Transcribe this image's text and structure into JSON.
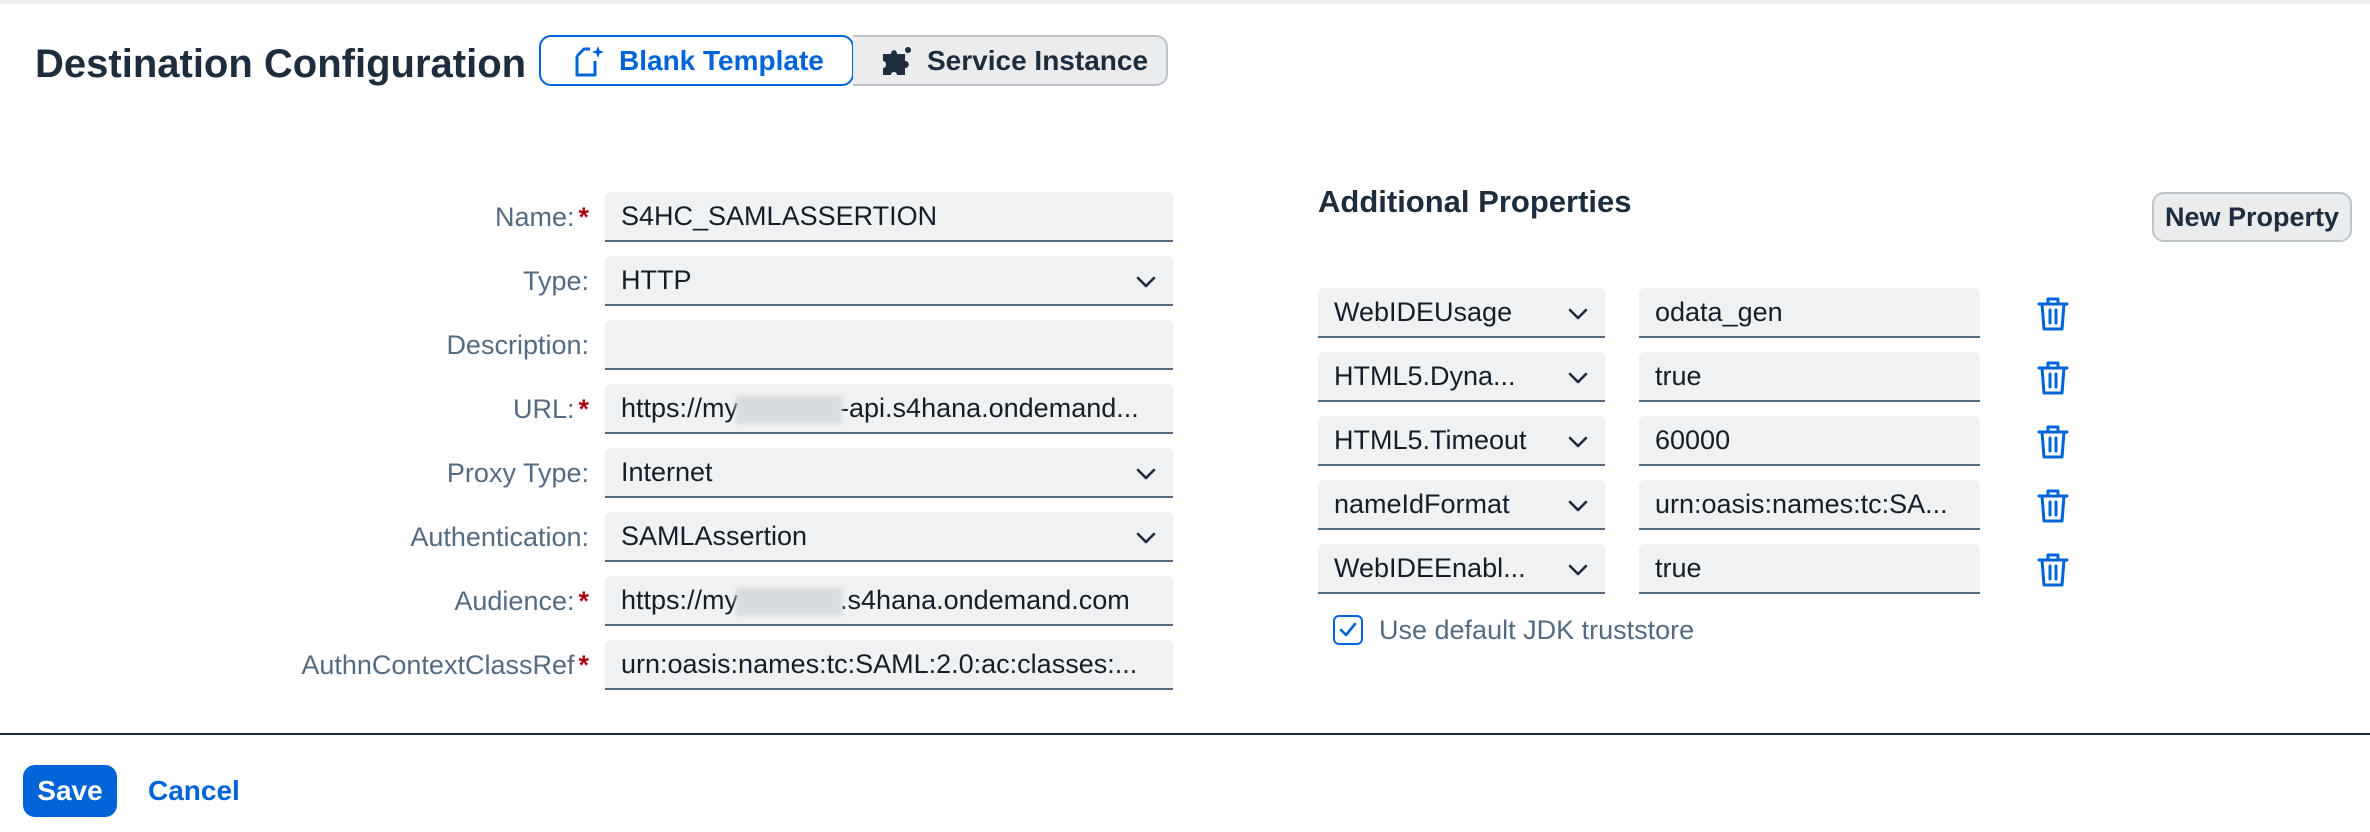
{
  "header": {
    "title": "Destination Configuration",
    "segments": [
      {
        "label": "Blank Template",
        "icon": "new-document-icon",
        "selected": true
      },
      {
        "label": "Service Instance",
        "icon": "puzzle-icon",
        "selected": false
      }
    ]
  },
  "form": {
    "name": {
      "label": "Name:",
      "required": true,
      "value": "S4HC_SAMLASSERTION"
    },
    "type": {
      "label": "Type:",
      "value": "HTTP"
    },
    "description": {
      "label": "Description:",
      "value": ""
    },
    "url": {
      "label": "URL:",
      "required": true,
      "value_prefix": "https://my",
      "value_suffix": "-api.s4hana.ondemand..."
    },
    "proxy_type": {
      "label": "Proxy Type:",
      "value": "Internet"
    },
    "authentication": {
      "label": "Authentication:",
      "value": "SAMLAssertion"
    },
    "audience": {
      "label": "Audience:",
      "required": true,
      "value_prefix": "https://my",
      "value_suffix": ".s4hana.ondemand.com"
    },
    "authn_context": {
      "label": "AuthnContextClassRef",
      "required": true,
      "value": "urn:oasis:names:tc:SAML:2.0:ac:classes:..."
    },
    "required_marker": "*"
  },
  "additional_properties": {
    "title": "Additional Properties",
    "new_property_label": "New Property",
    "rows": [
      {
        "key": "WebIDEUsage",
        "value": "odata_gen"
      },
      {
        "key": "HTML5.Dyna...",
        "value": "true"
      },
      {
        "key": "HTML5.Timeout",
        "value": "60000"
      },
      {
        "key": "nameIdFormat",
        "value": "urn:oasis:names:tc:SA..."
      },
      {
        "key": "WebIDEEnabl...",
        "value": "true"
      }
    ],
    "jdk_truststore": {
      "label": "Use default JDK truststore",
      "checked": true
    }
  },
  "footer": {
    "save_label": "Save",
    "cancel_label": "Cancel"
  },
  "colors": {
    "accent": "#0064d9",
    "required": "#aa0808",
    "label": "#556b82",
    "text": "#1d2d3e"
  }
}
